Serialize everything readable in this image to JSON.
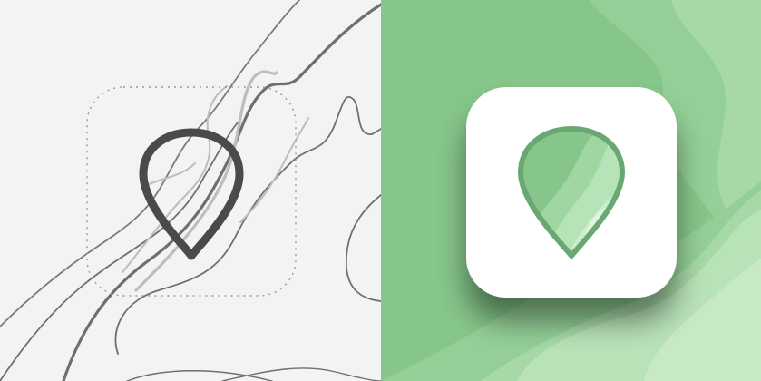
{
  "colors": {
    "left_background": "#f3f3f3",
    "sketch_contour_dark": "#6f6f6f",
    "sketch_contour_light": "#bdbdbd",
    "sketch_pin_stroke": "#4a4a4a",
    "sketch_guide_dots": "#9a9a9a",
    "right_background": "#86c68a",
    "terrain_layer_1": "#93cf96",
    "terrain_layer_2": "#a6d9a7",
    "terrain_layer_3": "#b8e2b8",
    "terrain_layer_4": "#c7e9c6",
    "app_tile": "#ffffff",
    "pin_outline": "#6aa873",
    "pin_fill_light": "#b6e3b8",
    "pin_fill_highlight": "#dff5de"
  },
  "icons": {
    "sketch_pin": "map-pin-outline-icon",
    "app_pin": "map-pin-topographic-icon"
  }
}
